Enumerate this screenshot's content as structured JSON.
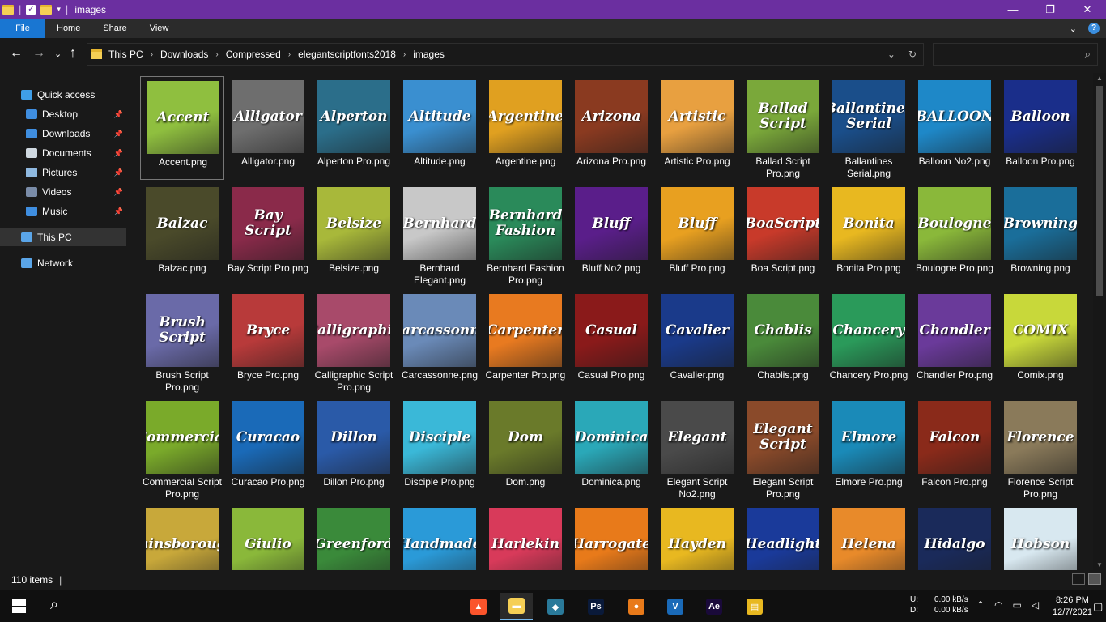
{
  "window": {
    "title": "images",
    "controls": {
      "minimize": "—",
      "maximize": "❐",
      "close": "✕"
    }
  },
  "ribbon": {
    "tabs": [
      "File",
      "Home",
      "Share",
      "View"
    ],
    "help": "?",
    "collapse": "⌄"
  },
  "nav": {
    "back": "←",
    "forward": "→",
    "recent": "⌄",
    "up": "↑",
    "breadcrumbs": [
      "This PC",
      "Downloads",
      "Compressed",
      "elegantscriptfonts2018",
      "images"
    ],
    "dropdown": "⌄",
    "refresh": "↻",
    "search_placeholder": "",
    "search_icon": "⌕"
  },
  "sidebar": {
    "items": [
      {
        "label": "Quick access",
        "icon": "star-icon",
        "color": "#3f9ee8"
      },
      {
        "label": "Desktop",
        "icon": "desktop-icon",
        "color": "#3f8ee0",
        "pinned": true
      },
      {
        "label": "Downloads",
        "icon": "download-icon",
        "color": "#3f8ee0",
        "pinned": true
      },
      {
        "label": "Documents",
        "icon": "document-icon",
        "color": "#cfd8e0",
        "pinned": true
      },
      {
        "label": "Pictures",
        "icon": "pictures-icon",
        "color": "#8fb9e0",
        "pinned": true
      },
      {
        "label": "Videos",
        "icon": "video-icon",
        "color": "#7a8ca8",
        "pinned": true
      },
      {
        "label": "Music",
        "icon": "music-icon",
        "color": "#3f8ee0",
        "pinned": true
      },
      {
        "label": "This PC",
        "icon": "computer-icon",
        "color": "#5aa5e8",
        "selected": true
      },
      {
        "label": "Network",
        "icon": "network-icon",
        "color": "#5aa5e8"
      }
    ]
  },
  "files": [
    {
      "name": "Accent.png",
      "thumb": "Accent",
      "bg": "#8fbf3f",
      "selected": true
    },
    {
      "name": "Alligator.png",
      "thumb": "Alligator",
      "bg": "#6e6e6e"
    },
    {
      "name": "Alperton Pro.png",
      "thumb": "Alperton",
      "bg": "#2b6e8a"
    },
    {
      "name": "Altitude.png",
      "thumb": "Altitude",
      "bg": "#3a8fd0"
    },
    {
      "name": "Argentine.png",
      "thumb": "Argentine",
      "bg": "#e0a020"
    },
    {
      "name": "Arizona Pro.png",
      "thumb": "Arizona",
      "bg": "#8a3a20"
    },
    {
      "name": "Artistic Pro.png",
      "thumb": "Artistic",
      "bg": "#e8a040"
    },
    {
      "name": "Ballad Script Pro.png",
      "thumb": "Ballad Script",
      "bg": "#7aa83a"
    },
    {
      "name": "Ballantines Serial.png",
      "thumb": "Ballantines Serial",
      "bg": "#1a4e8a"
    },
    {
      "name": "Balloon No2.png",
      "thumb": "BALLOON",
      "bg": "#1e88c8"
    },
    {
      "name": "Balloon Pro.png",
      "thumb": "Balloon",
      "bg": "#1a2e8a"
    },
    {
      "name": "Balzac.png",
      "thumb": "Balzac",
      "bg": "#4a4a2a"
    },
    {
      "name": "Bay Script Pro.png",
      "thumb": "Bay Script",
      "bg": "#8a2a4a"
    },
    {
      "name": "Belsize.png",
      "thumb": "Belsize",
      "bg": "#a8b83a"
    },
    {
      "name": "Bernhard Elegant.png",
      "thumb": "Bernhard",
      "bg": "#c8c8c8"
    },
    {
      "name": "Bernhard Fashion Pro.png",
      "thumb": "Bernhard Fashion",
      "bg": "#2a8a5a"
    },
    {
      "name": "Bluff No2.png",
      "thumb": "Bluff",
      "bg": "#5a1e8a"
    },
    {
      "name": "Bluff Pro.png",
      "thumb": "Bluff",
      "bg": "#e8a020"
    },
    {
      "name": "Boa Script.png",
      "thumb": "BoaScript",
      "bg": "#c83a2a"
    },
    {
      "name": "Bonita Pro.png",
      "thumb": "Bonita",
      "bg": "#e8b820"
    },
    {
      "name": "Boulogne Pro.png",
      "thumb": "Boulogne",
      "bg": "#8ab83a"
    },
    {
      "name": "Browning.png",
      "thumb": "Browning",
      "bg": "#1a6e9a"
    },
    {
      "name": "Brush Script Pro.png",
      "thumb": "Brush Script",
      "bg": "#6a6aa8"
    },
    {
      "name": "Bryce Pro.png",
      "thumb": "Bryce",
      "bg": "#b83a3a"
    },
    {
      "name": "Calligraphic Script Pro.png",
      "thumb": "Calligraphic",
      "bg": "#a84a6a"
    },
    {
      "name": "Carcassonne.png",
      "thumb": "Carcassonne",
      "bg": "#6a8ab8"
    },
    {
      "name": "Carpenter Pro.png",
      "thumb": "Carpenter",
      "bg": "#e87a20"
    },
    {
      "name": "Casual Pro.png",
      "thumb": "Casual",
      "bg": "#8a1a1a"
    },
    {
      "name": "Cavalier.png",
      "thumb": "Cavalier",
      "bg": "#1a3a8a"
    },
    {
      "name": "Chablis.png",
      "thumb": "Chablis",
      "bg": "#4a8a3a"
    },
    {
      "name": "Chancery Pro.png",
      "thumb": "Chancery",
      "bg": "#2a9a5a"
    },
    {
      "name": "Chandler Pro.png",
      "thumb": "Chandler",
      "bg": "#6a3a9a"
    },
    {
      "name": "Comix.png",
      "thumb": "COMIX",
      "bg": "#c8d83a"
    },
    {
      "name": "Commercial Script Pro.png",
      "thumb": "Commercial",
      "bg": "#7aaa2a"
    },
    {
      "name": "Curacao Pro.png",
      "thumb": "Curacao",
      "bg": "#1a6ab8"
    },
    {
      "name": "Dillon Pro.png",
      "thumb": "Dillon",
      "bg": "#2a5aa8"
    },
    {
      "name": "Disciple Pro.png",
      "thumb": "Disciple",
      "bg": "#3ab8d8"
    },
    {
      "name": "Dom.png",
      "thumb": "Dom",
      "bg": "#6a7a2a"
    },
    {
      "name": "Dominica.png",
      "thumb": "Dominica",
      "bg": "#2aa8b8"
    },
    {
      "name": "Elegant Script No2.png",
      "thumb": "Elegant",
      "bg": "#4a4a4a"
    },
    {
      "name": "Elegant Script Pro.png",
      "thumb": "Elegant Script",
      "bg": "#8a4a2a"
    },
    {
      "name": "Elmore Pro.png",
      "thumb": "Elmore",
      "bg": "#1a8ab8"
    },
    {
      "name": "Falcon Pro.png",
      "thumb": "Falcon",
      "bg": "#8a2a1a"
    },
    {
      "name": "Florence Script Pro.png",
      "thumb": "Florence",
      "bg": "#8a7a5a"
    },
    {
      "name": "",
      "thumb": "Gainsborough",
      "bg": "#c8a83a"
    },
    {
      "name": "",
      "thumb": "Giulio",
      "bg": "#8ab83a"
    },
    {
      "name": "",
      "thumb": "Greenford",
      "bg": "#3a8a3a"
    },
    {
      "name": "",
      "thumb": "Handmade",
      "bg": "#2a9ad8"
    },
    {
      "name": "",
      "thumb": "Harlekin",
      "bg": "#d83a5a"
    },
    {
      "name": "",
      "thumb": "Harrogate",
      "bg": "#e87a1a"
    },
    {
      "name": "",
      "thumb": "Hayden",
      "bg": "#e8b820"
    },
    {
      "name": "",
      "thumb": "Headlight",
      "bg": "#1a3a9a"
    },
    {
      "name": "",
      "thumb": "Helena",
      "bg": "#e88a2a"
    },
    {
      "name": "",
      "thumb": "Hidalgo",
      "bg": "#1a2a5a"
    },
    {
      "name": "",
      "thumb": "Hobson",
      "bg": "#d8e8f0"
    }
  ],
  "status": {
    "count": "110 items",
    "sep": "|"
  },
  "taskbar": {
    "search_icon": "⌕",
    "apps": [
      {
        "name": "brave-browser",
        "label": "▲",
        "bg": "#fb542b"
      },
      {
        "name": "file-explorer",
        "label": "▬",
        "bg": "#f5cf55",
        "active": true
      },
      {
        "name": "installer",
        "label": "◆",
        "bg": "#2a7a9a"
      },
      {
        "name": "photoshop",
        "label": "Ps",
        "bg": "#0a1a3a"
      },
      {
        "name": "fl-studio",
        "label": "●",
        "bg": "#e87a1a"
      },
      {
        "name": "vegas",
        "label": "V",
        "bg": "#1a6ab8"
      },
      {
        "name": "after-effects",
        "label": "Ae",
        "bg": "#1a0a3a"
      },
      {
        "name": "winrar",
        "label": "▤",
        "bg": "#e8b820"
      }
    ],
    "net_u_label": "U:",
    "net_d_label": "D:",
    "net_u": "0.00 kB/s",
    "net_d": "0.00 kB/s",
    "time": "8:26 PM",
    "date": "12/7/2021"
  }
}
